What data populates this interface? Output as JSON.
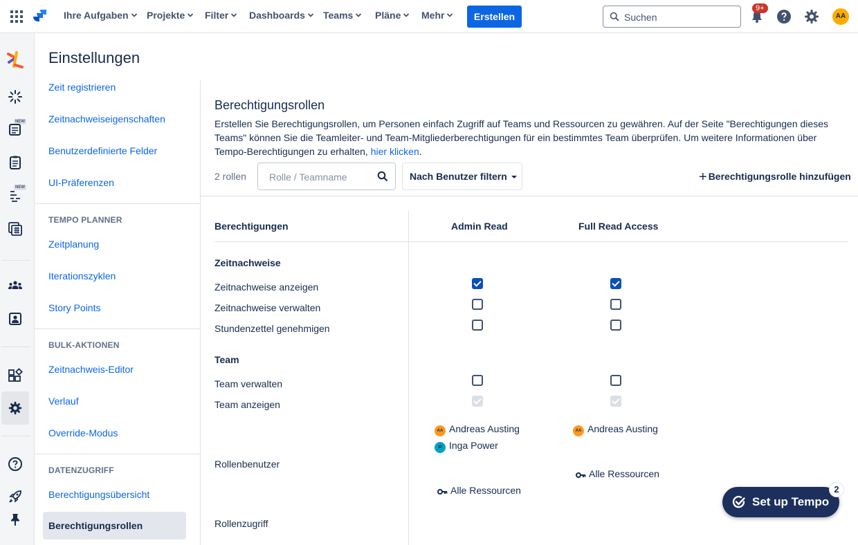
{
  "topbar": {
    "nav": [
      "Ihre Aufgaben",
      "Projekte",
      "Filter",
      "Dashboards",
      "Teams",
      "Pläne",
      "Mehr"
    ],
    "create_label": "Erstellen",
    "search_placeholder": "Suchen",
    "notification_count": "9+",
    "avatar_initials": "AA"
  },
  "rail": {
    "new_badge": "NEW"
  },
  "page": {
    "title": "Einstellungen"
  },
  "settings_nav": {
    "links_top": [
      "Zeit registrieren",
      "Zeitnachweiseigenschaften",
      "Benutzerdefinierte Felder",
      "UI-Präferenzen"
    ],
    "planner_heading": "TEMPO PLANNER",
    "planner_links": [
      "Zeitplanung",
      "Iterationszyklen",
      "Story Points"
    ],
    "bulk_heading": "BULK-AKTIONEN",
    "bulk_links": [
      "Zeitnachweis-Editor",
      "Verlauf",
      "Override-Modus"
    ],
    "data_heading": "DATENZUGRIFF",
    "data_links": [
      "Berechtigungsübersicht",
      "Berechtigungsrollen"
    ]
  },
  "main": {
    "title": "Berechtigungsrollen",
    "description": "Erstellen Sie Berechtigungsrollen, um Personen einfach Zugriff auf Teams und Ressourcen zu gewähren. Auf der Seite \"Berechtigungen dieses Teams\" können Sie die Teamleiter- und Team-Mitgliederberechtigungen für ein bestimmtes Team überprüfen. Um weitere Informationen über Tempo-Berechtigungen zu erhalten, ",
    "description_link": "hier klicken",
    "description_end": ".",
    "role_count": "2 rollen",
    "role_search_placeholder": "Rolle / Teamname",
    "user_filter_label": "Nach Benutzer filtern",
    "add_role_label": "Berechtigungsrolle hinzufügen"
  },
  "table": {
    "permissions_header": "Berechtigungen",
    "roles": [
      "Admin Read",
      "Full Read Access"
    ],
    "groups": [
      {
        "label": "Zeitnachweise",
        "rows": [
          {
            "label": "Zeitnachweise anzeigen",
            "states": [
              "checked",
              "checked"
            ]
          },
          {
            "label": "Zeitnachweise verwalten",
            "states": [
              "unchecked",
              "unchecked"
            ]
          },
          {
            "label": "Stundenzettel genehmigen",
            "states": [
              "unchecked",
              "unchecked"
            ]
          }
        ]
      },
      {
        "label": "Team",
        "rows": [
          {
            "label": "Team verwalten",
            "states": [
              "unchecked",
              "unchecked"
            ]
          },
          {
            "label": "Team anzeigen",
            "states": [
              "disabled",
              "disabled"
            ]
          }
        ]
      }
    ],
    "role_users_label": "Rollenbenutzer",
    "role_access_label": "Rollenzugriff",
    "role_users": [
      [
        {
          "initials": "AA",
          "name": "Andreas Austing",
          "color": "#ff991f"
        },
        {
          "initials": "IP",
          "name": "Inga Power",
          "color": "#00a3bf"
        }
      ],
      [
        {
          "initials": "AA",
          "name": "Andreas Austing",
          "color": "#ff991f"
        }
      ]
    ],
    "role_access": [
      "Alle Ressourcen",
      "Alle Ressourcen"
    ]
  },
  "cta": {
    "label": "Set up Tempo",
    "badge": "2"
  }
}
